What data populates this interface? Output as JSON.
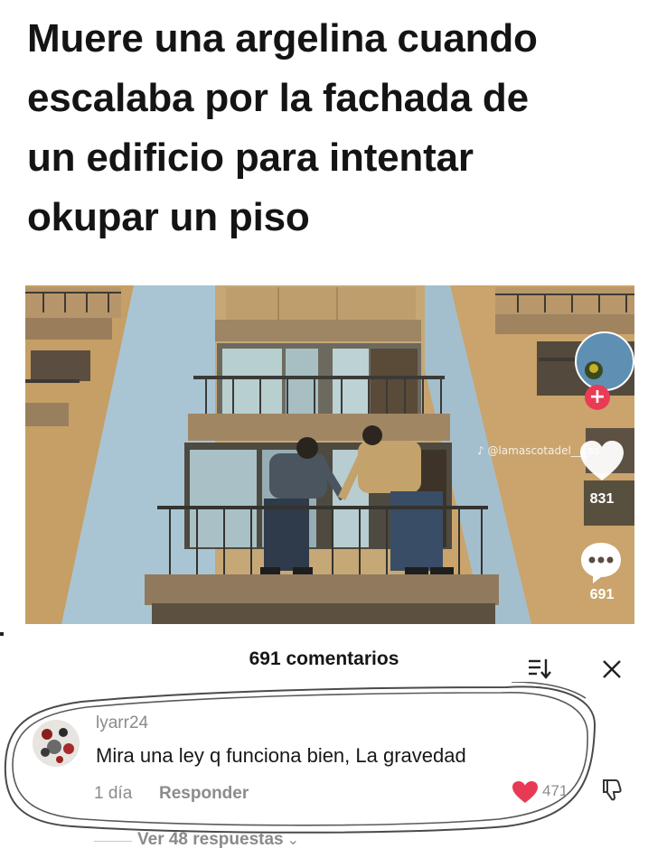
{
  "headline": {
    "line1": "Muere una argelina cuando",
    "line2": "escalaba por la fachada de",
    "line3": "un edificio para intentar",
    "line4": "okupar un piso"
  },
  "video": {
    "watermark": "♪ @lamascotadel___as",
    "like_count": "831",
    "comment_count": "691",
    "follow_symbol": "+"
  },
  "comments": {
    "header": "691 comentarios",
    "items": [
      {
        "username": "lyarr24",
        "text": "Mira una ley q funciona bien, La gravedad",
        "time": "1 día",
        "reply_label": "Responder",
        "likes": "471",
        "view_replies": "Ver 48 respuestas",
        "view_replies_chevron": "⌄"
      }
    ]
  },
  "colors": {
    "like_red": "#e83a55",
    "text_gray": "#8a8a8a",
    "wall_tan": "#c9a66d",
    "wall_blue": "#a9c3d1"
  }
}
